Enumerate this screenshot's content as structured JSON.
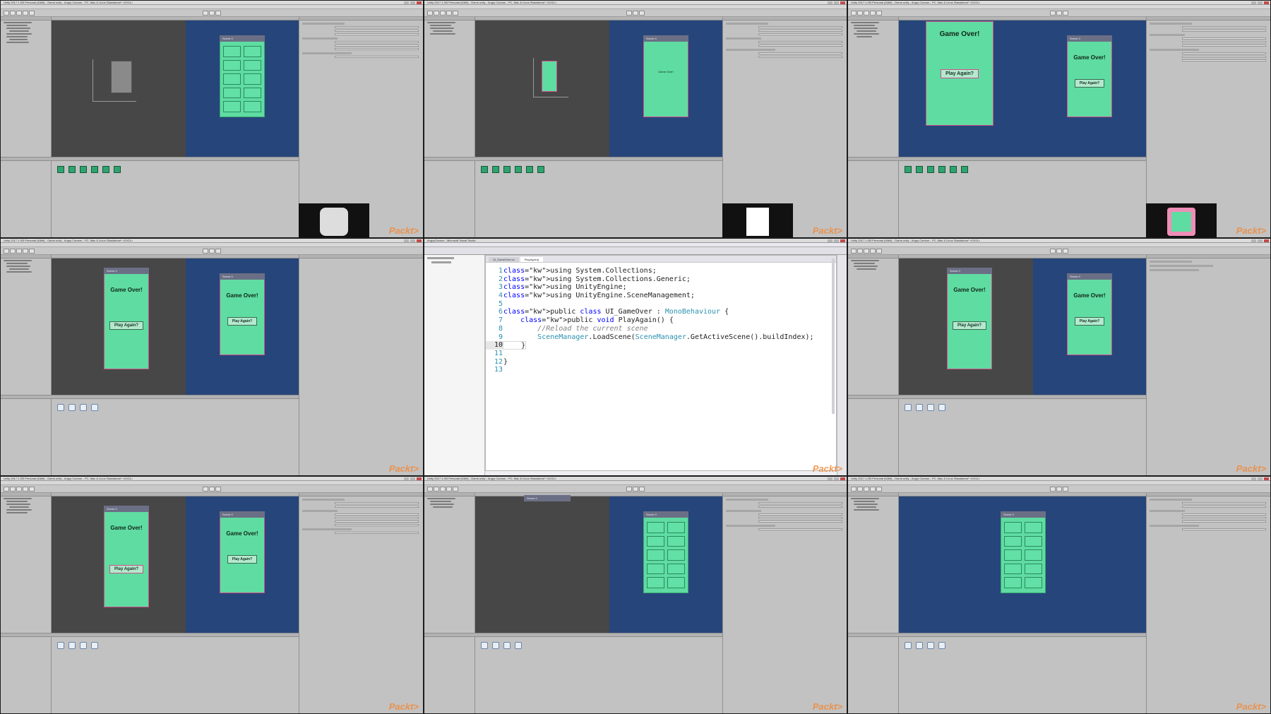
{
  "tile_title": "Unity 2017.1.0f3 Personal (64bit) - Game.unity - Angry Cannon - PC, Mac & Linux Standalone* <DX11>",
  "ide_title": "AngryCannon - Microsoft Visual Studio",
  "watermark": "Packt>",
  "game_over_label": "Game Over!",
  "play_again_label": "Play Again?",
  "scene_label": "Scene 0",
  "ide": {
    "tabs": [
      "UI_GameOver.cs",
      "PlayAgain()"
    ],
    "code": [
      {
        "n": "1",
        "t": "using System.Collections;"
      },
      {
        "n": "2",
        "t": "using System.Collections.Generic;"
      },
      {
        "n": "3",
        "t": "using UnityEngine;"
      },
      {
        "n": "4",
        "t": "using UnityEngine.SceneManagement;"
      },
      {
        "n": "5",
        "t": ""
      },
      {
        "n": "6",
        "t": "public class UI_GameOver : MonoBehaviour {"
      },
      {
        "n": "7",
        "t": "    public void PlayAgain() {"
      },
      {
        "n": "8",
        "t": "        //Reload the current scene"
      },
      {
        "n": "9",
        "t": "        SceneManager.LoadScene(SceneManager.GetActiveScene().buildIndex);"
      },
      {
        "n": "10",
        "t": "    }"
      },
      {
        "n": "11",
        "t": ""
      },
      {
        "n": "12",
        "t": "}"
      },
      {
        "n": "13",
        "t": ""
      }
    ]
  },
  "colors": {
    "canvas_green": "#5fdca1",
    "game_view_blue": "#26457a",
    "keyword_blue": "#0000ff",
    "type_teal": "#2b91af",
    "watermark_orange": "#f08a3c"
  }
}
